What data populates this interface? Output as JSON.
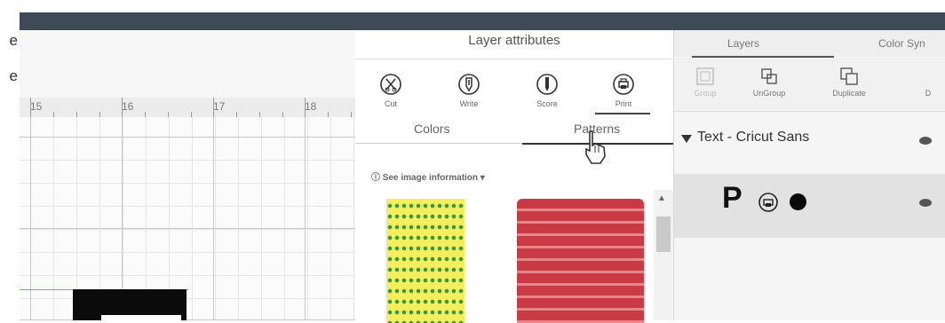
{
  "left_strip": {
    "line1": "e",
    "line2": "e"
  },
  "ruler": {
    "labels": [
      "15",
      "16",
      "17",
      "18"
    ]
  },
  "attributes_panel": {
    "title": "Layer attributes",
    "tools": [
      {
        "label": "Cut",
        "icon": "scissors-icon"
      },
      {
        "label": "Write",
        "icon": "pen-icon"
      },
      {
        "label": "Score",
        "icon": "score-icon"
      },
      {
        "label": "Print",
        "icon": "printer-icon"
      }
    ],
    "tabs": {
      "colors": "Colors",
      "patterns": "Patterns"
    },
    "image_info": "See image information"
  },
  "layers_panel": {
    "tabs": {
      "layers": "Layers",
      "color_sync": "Color Syn"
    },
    "tools": [
      {
        "label": "Group",
        "icon": "group-icon"
      },
      {
        "label": "UnGroup",
        "icon": "ungroup-icon"
      },
      {
        "label": "Duplicate",
        "icon": "duplicate-icon"
      },
      {
        "label": "D",
        "icon": "delete-icon"
      }
    ],
    "group": {
      "label": "Text - Cricut Sans"
    },
    "layer": {
      "glyph": "P"
    }
  },
  "colors": {
    "topbar": "#3e4a55",
    "pattern_yellow": "#f5ef5e",
    "pattern_red": "#c93a44"
  }
}
